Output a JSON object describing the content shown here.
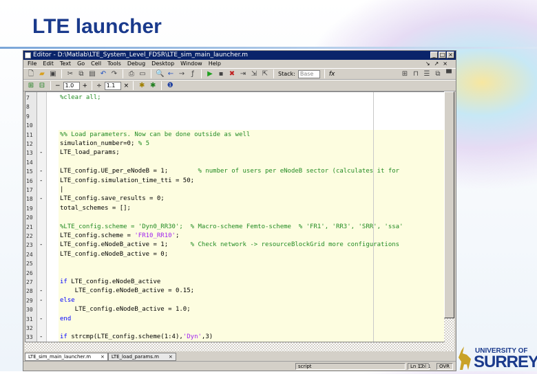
{
  "slide": {
    "title": "LTE launcher"
  },
  "window": {
    "title": "Editor - D:\\Matlab\\LTE_System_Level_FDSR\\LTE_sim_main_launcher.m"
  },
  "menu": [
    "File",
    "Edit",
    "Text",
    "Go",
    "Cell",
    "Tools",
    "Debug",
    "Desktop",
    "Window",
    "Help"
  ],
  "toolbar": {
    "stack_label": "Stack:",
    "stack_value": "Base",
    "fx": "fx",
    "cell_minus": "−",
    "cell_value1": "1.0",
    "cell_plus": "+",
    "cell_div": "÷",
    "cell_value2": "1.1",
    "cell_times": "×"
  },
  "lines": [
    {
      "n": "7",
      "d": "",
      "segs": [
        {
          "t": "%clear all;",
          "c": "c"
        }
      ]
    },
    {
      "n": "8",
      "d": "",
      "segs": []
    },
    {
      "n": "9",
      "d": "",
      "segs": []
    },
    {
      "n": "10",
      "d": "",
      "segs": []
    },
    {
      "n": "11",
      "d": "",
      "segs": [
        {
          "t": "%% Load parameters. Now can be done outside as well",
          "c": "c"
        }
      ]
    },
    {
      "n": "12",
      "d": "",
      "segs": [
        {
          "t": "simulation_number=0; ",
          "c": ""
        },
        {
          "t": "% 5",
          "c": "c"
        }
      ]
    },
    {
      "n": "13",
      "d": "-",
      "segs": [
        {
          "t": "LTE_load_params;",
          "c": ""
        }
      ]
    },
    {
      "n": "14",
      "d": "",
      "segs": []
    },
    {
      "n": "15",
      "d": "-",
      "segs": [
        {
          "t": "LTE_config.UE_per_eNodeB = 1;        ",
          "c": ""
        },
        {
          "t": "% number of users per eNodeB sector (calculates it for",
          "c": "c"
        }
      ]
    },
    {
      "n": "16",
      "d": "-",
      "segs": [
        {
          "t": "LTE_config.simulation_time_tti = 50;",
          "c": ""
        }
      ]
    },
    {
      "n": "17",
      "d": "",
      "segs": [
        {
          "t": "|",
          "c": ""
        }
      ]
    },
    {
      "n": "18",
      "d": "-",
      "segs": [
        {
          "t": "LTE_config.save_results = 0;",
          "c": ""
        }
      ]
    },
    {
      "n": "19",
      "d": "",
      "segs": [
        {
          "t": "total_schemes = [];",
          "c": ""
        }
      ]
    },
    {
      "n": "20",
      "d": "",
      "segs": []
    },
    {
      "n": "21",
      "d": "",
      "segs": [
        {
          "t": "%LTE_config.scheme = 'Dyn0_RR30';  % Macro-scheme Femto-scheme  % 'FR1', 'RR3', 'SRR', 'ssa'",
          "c": "c"
        }
      ]
    },
    {
      "n": "22",
      "d": "",
      "segs": [
        {
          "t": "LTE_config.scheme = ",
          "c": ""
        },
        {
          "t": "'FR10_RR10'",
          "c": "s"
        },
        {
          "t": ";",
          "c": ""
        }
      ]
    },
    {
      "n": "23",
      "d": "-",
      "segs": [
        {
          "t": "LTE_config.eNodeB_active = 1;      ",
          "c": ""
        },
        {
          "t": "% Check network -> resourceBlockGrid more configurations",
          "c": "c"
        }
      ]
    },
    {
      "n": "24",
      "d": "",
      "segs": [
        {
          "t": "LTE_config.eNodeB_active = 0;",
          "c": ""
        }
      ]
    },
    {
      "n": "25",
      "d": "",
      "segs": []
    },
    {
      "n": "26",
      "d": "",
      "segs": []
    },
    {
      "n": "27",
      "d": "",
      "segs": [
        {
          "t": "if",
          "c": "k"
        },
        {
          "t": " LTE_config.eNodeB_active",
          "c": ""
        }
      ]
    },
    {
      "n": "28",
      "d": "-",
      "segs": [
        {
          "t": "    LTE_config.eNodeB_active = 0.15;",
          "c": ""
        }
      ]
    },
    {
      "n": "29",
      "d": "-",
      "segs": [
        {
          "t": "else",
          "c": "k"
        }
      ]
    },
    {
      "n": "30",
      "d": "",
      "segs": [
        {
          "t": "    LTE_config.eNodeB_active = 1.0;",
          "c": ""
        }
      ]
    },
    {
      "n": "31",
      "d": "-",
      "segs": [
        {
          "t": "end",
          "c": "k"
        }
      ]
    },
    {
      "n": "32",
      "d": "",
      "segs": []
    },
    {
      "n": "33",
      "d": "-",
      "segs": [
        {
          "t": "if",
          "c": "k"
        },
        {
          "t": " strcmp(LTE_config.scheme(1:4),",
          "c": ""
        },
        {
          "t": "'Dyn'",
          "c": "s"
        },
        {
          "t": ",3)",
          "c": ""
        }
      ]
    }
  ],
  "tabs": [
    "LTE_sim_main_launcher.m",
    "LTE_load_params.m"
  ],
  "tab_close": "×",
  "status": {
    "mode": "script",
    "ln": "Ln 17",
    "col": "Col 1",
    "ovr": "OVR"
  },
  "logo": {
    "line1": "UNIVERSITY OF",
    "line2": "SURREY"
  }
}
